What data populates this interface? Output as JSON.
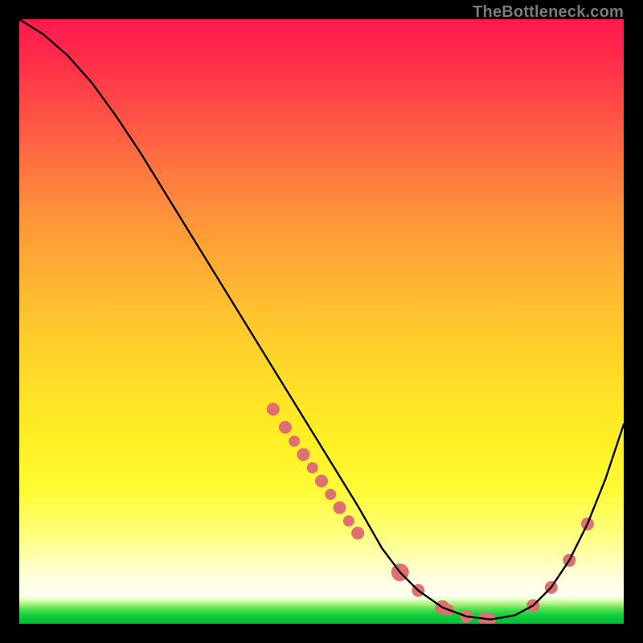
{
  "watermark": {
    "text": "TheBottleneck.com"
  },
  "chart_data": {
    "type": "line",
    "title": "",
    "xlabel": "",
    "ylabel": "",
    "xlim": [
      0,
      100
    ],
    "ylim": [
      0,
      100
    ],
    "grid": false,
    "legend": false,
    "series": [
      {
        "name": "curve",
        "x": [
          0,
          4,
          8,
          12,
          16,
          20,
          24,
          28,
          32,
          36,
          40,
          44,
          48,
          52,
          56,
          58,
          60,
          63,
          66,
          70,
          74,
          78,
          82,
          85,
          88,
          91,
          94,
          97,
          100
        ],
        "y": [
          100,
          97.5,
          94,
          89.5,
          84,
          78,
          71.5,
          65,
          58.5,
          52,
          45.5,
          39,
          32.5,
          26,
          19.5,
          16,
          12.5,
          8.5,
          5.5,
          2.7,
          1.2,
          0.7,
          1.4,
          3.0,
          6.0,
          10.5,
          16.5,
          24,
          33
        ]
      }
    ],
    "scatter": [
      {
        "name": "dots",
        "color": "#e07070",
        "x": [
          42,
          44,
          45.5,
          47,
          48.5,
          50,
          51.5,
          53,
          54.5,
          56,
          63,
          66,
          70,
          71,
          74,
          77,
          78,
          85,
          88,
          91,
          94
        ],
        "y": [
          35.5,
          32.5,
          30.2,
          28,
          25.8,
          23.6,
          21.4,
          19.2,
          17.0,
          15.0,
          8.5,
          5.5,
          2.7,
          2.3,
          1.2,
          0.8,
          0.7,
          3.0,
          6.0,
          10.5,
          16.5
        ],
        "r": [
          8,
          8,
          7,
          8,
          7,
          8,
          7,
          8,
          7,
          8,
          11,
          8,
          9,
          7,
          8,
          8,
          7,
          8,
          8,
          8,
          8
        ]
      }
    ]
  }
}
